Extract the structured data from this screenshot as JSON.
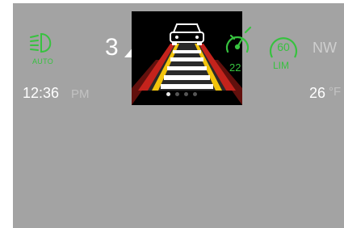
{
  "headlight": {
    "icon": "auto-headlight-icon",
    "label": "AUTO",
    "color": "#37c23f"
  },
  "gear": {
    "value": "3",
    "direction_icon": "up-arrow-icon"
  },
  "adas_view": {
    "scene": "lead-vehicle-lane-view",
    "pages_total": 4,
    "page_active": 1
  },
  "cruise": {
    "icon": "adaptive-cruise-icon",
    "speed": "22",
    "color": "#37c23f"
  },
  "speed_limit": {
    "value": "60",
    "label": "LIM",
    "color": "#37c23f"
  },
  "heading": "NW",
  "clock": {
    "time": "12:36",
    "ampm": "PM"
  },
  "temperature": {
    "value": "26",
    "unit": "°F"
  },
  "colors": {
    "background": "#a3a3a3",
    "accent_green": "#37c23f",
    "lane_yellow": "#f2c40c",
    "lane_red": "#c4231c"
  }
}
